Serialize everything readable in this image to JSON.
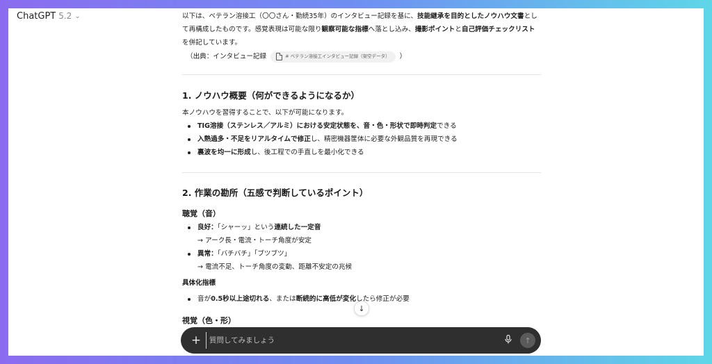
{
  "header": {
    "model_name": "ChatGPT",
    "model_version": "5.2"
  },
  "intro": {
    "p1_a": "以下は、ベテラン溶接工（〇〇さん・勤続35年）のインタビュー記録を基に、",
    "p1_b": "技能継承を目的としたノウハウ文書",
    "p1_c": "として再構成したものです。感覚表現は可能な限り",
    "p1_d": "観察可能な指標",
    "p1_e": "へ落とし込み、",
    "p1_f": "撮影ポイント",
    "p1_g": "と",
    "p1_h": "自己評価チェックリスト",
    "p1_i": "を併記しています。",
    "source_prefix": "（出典：インタビュー記録",
    "source_chip": "# ベテラン溶接工インタビュー記録（架空データ）",
    "source_suffix": "）"
  },
  "section1": {
    "title": "1. ノウハウ概要（何ができるようになるか）",
    "lead": "本ノウハウを習得することで、以下が可能になります。",
    "b1_bold": "TIG溶接（ステンレス／アルミ）における安定状態を、音・色・形状で即時判定",
    "b1_rest": "できる",
    "b2_bold": "入熱過多・不足をリアルタイムで修正",
    "b2_rest": "し、精密機器筐体に必要な外観品質を再現できる",
    "b3_bold": "裏波を均一に形成",
    "b3_rest": "し、後工程での手直しを最小化できる"
  },
  "section2": {
    "title": "2. 作業の勘所（五感で判断しているポイント）",
    "sub_hearing": "聴覚（音）",
    "good_label": "良好：",
    "good_a": "「シャーッ」という",
    "good_b": "連続した一定音",
    "good_arrow": "→ アーク長・電流・トーチ角度が安定",
    "bad_label": "異常：",
    "bad_text": "「バチバチ」「ブツブツ」",
    "bad_arrow": "→ 電流不足、トーチ角度の変動、距離不安定の兆候",
    "concrete_title": "具体化指標",
    "concrete_a": "音が",
    "concrete_b": "0.5秒以上途切れる",
    "concrete_c": "、または",
    "concrete_d": "断続的に高低が変化",
    "concrete_e": "したら修正が必要",
    "sub_vision": "視覚（色・形）"
  },
  "composer": {
    "placeholder": "質問してみましょう"
  }
}
